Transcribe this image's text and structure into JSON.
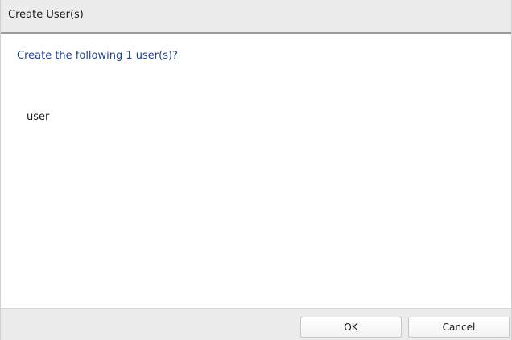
{
  "dialog": {
    "title": "Create User(s)",
    "prompt": "Create the following 1 user(s)?",
    "users": [
      "user"
    ],
    "buttons": {
      "ok_label": "OK",
      "cancel_label": "Cancel"
    }
  },
  "colors": {
    "titlebar_bg": "#ececec",
    "prompt_text": "#1f3f8f",
    "footer_bg": "#ececec"
  }
}
